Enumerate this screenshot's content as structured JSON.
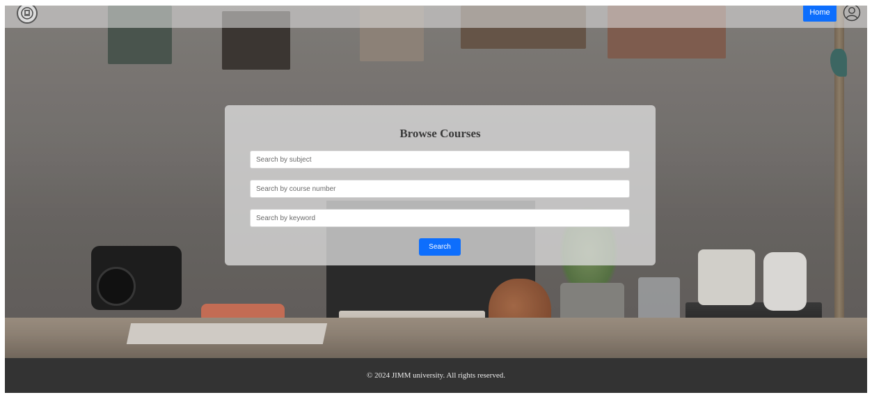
{
  "header": {
    "logo_icon": "university-seal-icon",
    "home_label": "Home",
    "user_icon": "user-circle-icon"
  },
  "search_card": {
    "title": "Browse Courses",
    "subject_placeholder": "Search by subject",
    "subject_value": "",
    "course_number_placeholder": "Search by course number",
    "course_number_value": "",
    "keyword_placeholder": "Search by keyword",
    "keyword_value": "",
    "search_label": "Search"
  },
  "footer": {
    "copyright": "© 2024 JIMM university. All rights reserved."
  },
  "colors": {
    "primary_button": "#0d6efd",
    "footer_bg": "#333333",
    "card_bg": "#dcdcdc"
  }
}
